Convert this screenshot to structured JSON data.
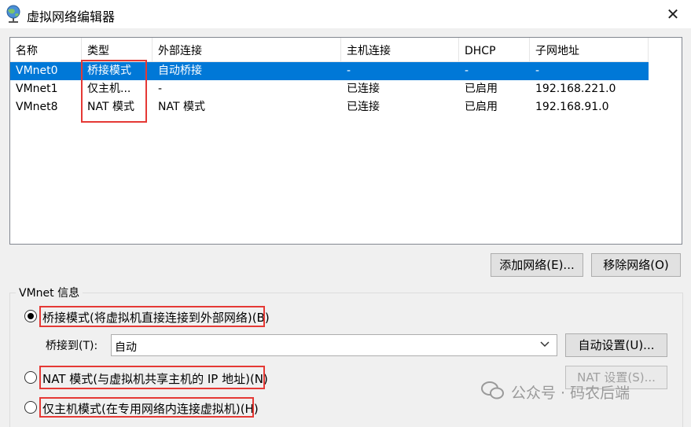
{
  "window": {
    "title": "虚拟网络编辑器",
    "close_glyph": "✕",
    "icon": "network-globe-icon"
  },
  "table": {
    "columns": [
      "名称",
      "类型",
      "外部连接",
      "主机连接",
      "DHCP",
      "子网地址"
    ],
    "rows": [
      [
        "VMnet0",
        "桥接模式",
        "自动桥接",
        "-",
        "-",
        "-"
      ],
      [
        "VMnet1",
        "仅主机...",
        "-",
        "已连接",
        "已启用",
        "192.168.221.0"
      ],
      [
        "VMnet8",
        "NAT 模式",
        "NAT 模式",
        "已连接",
        "已启用",
        "192.168.91.0"
      ]
    ],
    "selected_row": 0
  },
  "buttons": {
    "add_network": "添加网络(E)...",
    "remove_network": "移除网络(O)"
  },
  "vmnet_info": {
    "group_label": "VMnet 信息",
    "bridged_option": "桥接模式(将虚拟机直接连接到外部网络)(B)",
    "bridged_to_label": "桥接到(T):",
    "bridged_to_value": "自动",
    "auto_settings": "自动设置(U)...",
    "nat_option": "NAT 模式(与虚拟机共享主机的 IP 地址)(N)",
    "nat_settings": "NAT 设置(S)...",
    "host_only_option": "仅主机模式(在专用网络内连接虚拟机)(H)",
    "selected_option": "bridged"
  },
  "watermark": "公众号 · 码农后端",
  "colors": {
    "selection": "#0078d7",
    "highlight_box": "#e53935"
  }
}
